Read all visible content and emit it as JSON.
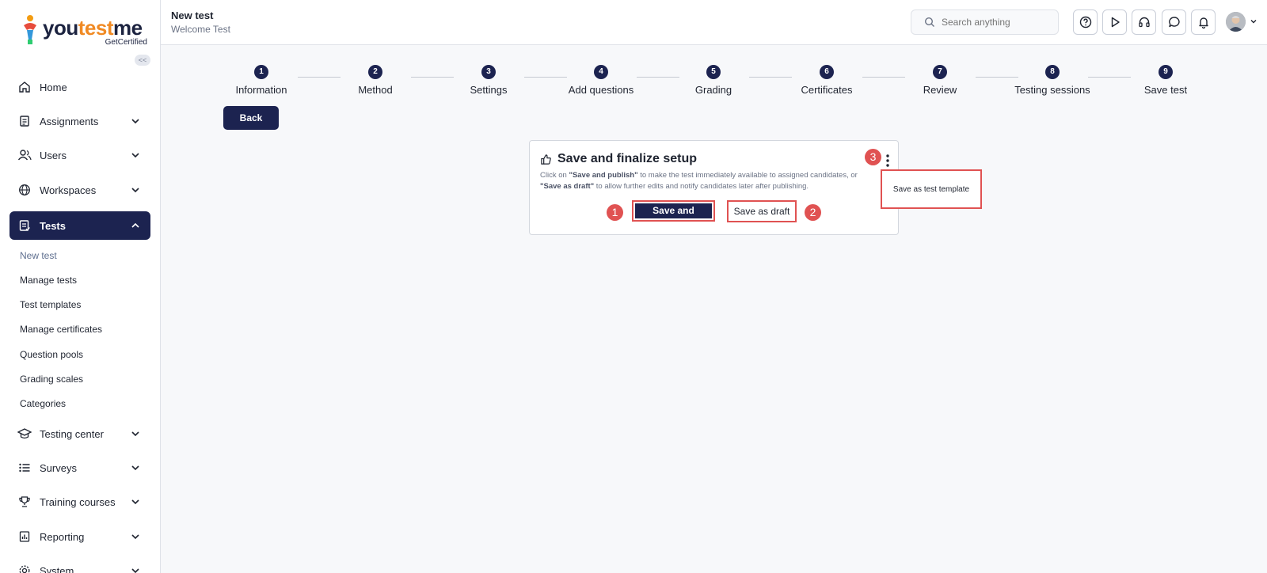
{
  "brand": {
    "name_part1": "you",
    "name_part2": "test",
    "name_part3": "me",
    "tagline": "GetCertified"
  },
  "sidebar": {
    "collapse_label": "<<",
    "items": [
      {
        "label": "Home",
        "icon": "home-icon"
      },
      {
        "label": "Assignments",
        "icon": "document-icon"
      },
      {
        "label": "Users",
        "icon": "users-icon"
      },
      {
        "label": "Workspaces",
        "icon": "globe-icon"
      },
      {
        "label": "Tests",
        "icon": "test-list-icon"
      },
      {
        "label": "Testing center",
        "icon": "graduation-cap-icon"
      },
      {
        "label": "Surveys",
        "icon": "list-icon"
      },
      {
        "label": "Training courses",
        "icon": "trophy-icon"
      },
      {
        "label": "Reporting",
        "icon": "report-icon"
      },
      {
        "label": "System",
        "icon": "gear-icon"
      }
    ],
    "tests_sub": [
      "New test",
      "Manage tests",
      "Test templates",
      "Manage certificates",
      "Question pools",
      "Grading scales",
      "Categories"
    ]
  },
  "header": {
    "title": "New test",
    "subtitle": "Welcome Test",
    "search_placeholder": "Search anything"
  },
  "stepper": {
    "steps": [
      {
        "num": "1",
        "label": "Information"
      },
      {
        "num": "2",
        "label": "Method"
      },
      {
        "num": "3",
        "label": "Settings"
      },
      {
        "num": "4",
        "label": "Add questions"
      },
      {
        "num": "5",
        "label": "Grading"
      },
      {
        "num": "6",
        "label": "Certificates"
      },
      {
        "num": "7",
        "label": "Review"
      },
      {
        "num": "8",
        "label": "Testing sessions"
      },
      {
        "num": "9",
        "label": "Save test"
      }
    ]
  },
  "back_label": "Back",
  "card": {
    "title": "Save and finalize setup",
    "desc_1": "Click on ",
    "desc_b1": "\"Save and publish\"",
    "desc_2": " to make the test immediately available to assigned candidates, or ",
    "desc_b2": "\"Save as draft\"",
    "desc_3": " to allow further edits and notify candidates later after publishing.",
    "publish_label": "Save and publish",
    "draft_label": "Save as draft"
  },
  "dropdown": {
    "item": "Save as test template"
  },
  "markers": [
    "1",
    "2",
    "3"
  ],
  "colors": {
    "primary": "#1c2350",
    "highlight": "#e05252"
  }
}
